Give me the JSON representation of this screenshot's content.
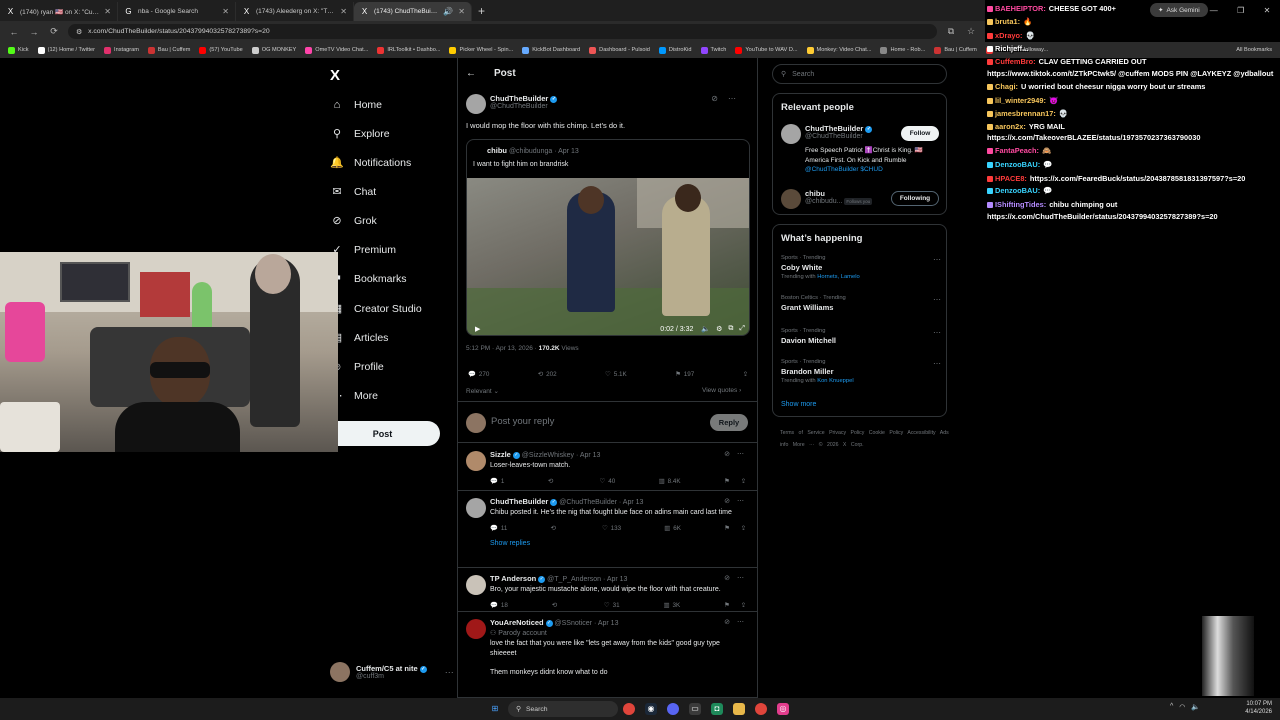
{
  "browser": {
    "tabs": [
      {
        "label": "(1740) ryan 🇺🇸 on X: \"Cuffem ...",
        "fav": "X",
        "active": false
      },
      {
        "label": "nba - Google Search",
        "fav": "G",
        "active": false
      },
      {
        "label": "(1743) Aleederg on X: \"This is th...",
        "fav": "X",
        "active": false
      },
      {
        "label": "(1743) ChudTheBuilder on",
        "fav": "X",
        "active": true
      }
    ],
    "new_tab": "+",
    "url": "x.com/ChudTheBuilder/status/2043799403257827389?s=20",
    "ask_gemini": "Ask Gemini",
    "all_bookmarks": "All Bookmarks",
    "bookmarks": [
      "Kick",
      "(12) Home / Twitter",
      "Instagram",
      "Bau | Cuffem",
      "(57) YouTube",
      "OG MONKEY",
      "OmeTV Video Chat...",
      "IRLToolkit • Dashbo...",
      "Picker Wheel - Spin...",
      "KickBot Dashboard",
      "Dashboard - Pulsoid",
      "DistroKid",
      "Twitch",
      "YouTube to WAV D...",
      "Monkey: Video Chat...",
      "Home - Rob...",
      "Bau | Cuffem",
      "UFC 326: Holloway..."
    ]
  },
  "nav": {
    "logo": "X",
    "items": [
      {
        "label": "Home",
        "icon": "⌂",
        "name": "home"
      },
      {
        "label": "Explore",
        "icon": "⚲",
        "name": "explore"
      },
      {
        "label": "Notifications",
        "icon": "🔔",
        "name": "notifications",
        "badge": "20"
      },
      {
        "label": "Chat",
        "icon": "✉",
        "name": "chat",
        "badge": "20+"
      },
      {
        "label": "Grok",
        "icon": "⊘",
        "name": "grok"
      },
      {
        "label": "Premium",
        "icon": "✓",
        "name": "premium"
      },
      {
        "label": "Bookmarks",
        "icon": "⚑",
        "name": "bookmarks"
      },
      {
        "label": "Creator Studio",
        "icon": "▦",
        "name": "creator-studio"
      },
      {
        "label": "Articles",
        "icon": "▤",
        "name": "articles"
      },
      {
        "label": "Profile",
        "icon": "☺",
        "name": "profile"
      },
      {
        "label": "More",
        "icon": "⋯",
        "name": "more"
      }
    ],
    "post_button": "Post",
    "account": {
      "name": "Cuffem/C5 at nite",
      "handle": "@cuff3m"
    }
  },
  "post": {
    "header": "Post",
    "author": {
      "name": "ChudTheBuilder",
      "handle": "@ChudTheBuilder"
    },
    "text": "I would mop the floor with this chimp. Let’s do it.",
    "quote": {
      "name": "chibu",
      "handle": "@chibudunga",
      "date": "· Apr 13",
      "text": "I want to fight him on brandrisk",
      "video_time": "0:02 / 3:32"
    },
    "timestamp": "5:12 PM · Apr 13, 2026 ·",
    "views_count": "170.2K",
    "views_label": "Views",
    "stats": {
      "replies": "270",
      "reposts": "202",
      "likes": "5.1K",
      "bookmarks": "197"
    },
    "relevant": "Relevant",
    "view_quotes": "View quotes",
    "reply_placeholder": "Post your reply",
    "reply_button": "Reply"
  },
  "replies": [
    {
      "name": "Sizzle",
      "handle": "@SizzleWhiskey",
      "date": "· Apr 13",
      "text": "Loser-leaves-town match.",
      "stats": {
        "replies": "1",
        "reposts": "",
        "likes": "40",
        "views": "8.4K"
      }
    },
    {
      "name": "ChudTheBuilder",
      "handle": "@ChudTheBuilder",
      "date": "· Apr 13",
      "text": "Chibu posted it. He’s the nig that fought blue face on adins main card last time",
      "stats": {
        "replies": "11",
        "reposts": "",
        "likes": "133",
        "views": "6K"
      },
      "show_replies": "Show replies"
    },
    {
      "name": "TP Anderson",
      "handle": "@T_P_Anderson",
      "date": "· Apr 13",
      "text": "Bro, your majestic mustache alone, would wipe the floor with that creature.",
      "stats": {
        "replies": "18",
        "reposts": "",
        "likes": "31",
        "views": "3K"
      }
    },
    {
      "name": "YouAreNoticed",
      "handle": "@SSnoticer",
      "date": "· Apr 13",
      "tag": "Parody account",
      "text": "love the fact that you were like \"lets get away from the kids\" good guy type shieeeet",
      "text2": "Them monkeys didnt know what to do"
    }
  ],
  "sidebar": {
    "search_placeholder": "Search",
    "relevant_people_title": "Relevant people",
    "people": [
      {
        "name": "ChudTheBuilder",
        "handle": "@ChudTheBuilder",
        "bio": "Free Speech Patriot ✝️Christ is King. 🇺🇸America First. On Kick and Rumble",
        "bio_links": "@ChudTheBuilder $CHUD",
        "button": "Follow"
      },
      {
        "name": "chibu",
        "handle": "@chibudu...",
        "follows_you": "Follows you",
        "button": "Following"
      }
    ],
    "happening_title": "What’s happening",
    "trends": [
      {
        "meta": "Sports · Trending",
        "title": "Coby White",
        "with_label": "Trending with",
        "with": "Hornets, Lamelo"
      },
      {
        "meta": "Boston Celtics · Trending",
        "title": "Grant Williams"
      },
      {
        "meta": "Sports · Trending",
        "title": "Davion Mitchell"
      },
      {
        "meta": "Sports · Trending",
        "title": "Brandon Miller",
        "with_label": "Trending with",
        "with": "Kon Knueppel"
      }
    ],
    "show_more": "Show more",
    "footer": "Terms of Service   Privacy Policy   Cookie Policy   Accessibility   Ads info   More ···   © 2026 X Corp."
  },
  "chat": [
    {
      "user": "BAEHEIPTOR:",
      "msg": "CHEESE GOT 400+",
      "color": "#ff4aa0"
    },
    {
      "user": "bruta1:",
      "msg": "🔥",
      "color": "#f7c65c"
    },
    {
      "user": "xDrayo:",
      "msg": "💀",
      "color": "#ff3b3b"
    },
    {
      "user": "Richjeff...",
      "msg": "",
      "color": "#ffffff"
    },
    {
      "user": "CuffemBro:",
      "msg": "CLAV GETTING CARRIED OUT",
      "color": "#ff3b3b"
    },
    {
      "user": "",
      "msg": "https://www.tiktok.com/t/ZTkPCtwk5/ @cuffem MODS PIN @LAYKEYZ @ydballout",
      "color": "#ffffff"
    },
    {
      "user": "Chagi:",
      "msg": "U worried bout cheesur nigga worry bout ur streams",
      "color": "#f7c65c"
    },
    {
      "user": "lil_winter2949:",
      "msg": "😈",
      "color": "#f7c65c"
    },
    {
      "user": "jamesbrennan17:",
      "msg": "💀",
      "color": "#f7c65c"
    },
    {
      "user": "aaron2x:",
      "msg": "YRG MAIL",
      "color": "#f7c65c"
    },
    {
      "user": "",
      "msg": "https://x.com/TakeoverBLAZEE/status/1973570237363790030",
      "color": "#ffffff"
    },
    {
      "user": "FantaPeach:",
      "msg": "🙈",
      "color": "#ff4aa0"
    },
    {
      "user": "DenzooBAU:",
      "msg": "💬",
      "color": "#39d4ff"
    },
    {
      "user": "HPACE8:",
      "msg": "https://x.com/FearedBuck/status/2043878581831397597?s=20",
      "color": "#ff3b3b"
    },
    {
      "user": "DenzooBAU:",
      "msg": "💬",
      "color": "#39d4ff"
    },
    {
      "user": "IShiftingTides:",
      "msg": "chibu chimping out",
      "color": "#b48bff"
    },
    {
      "user": "",
      "msg": "https://x.com/ChudTheBuilder/status/2043799403257827389?s=20",
      "color": "#ffffff"
    }
  ],
  "taskbar": {
    "search_placeholder": "Search",
    "time": "10:07 PM",
    "date": "4/14/2026"
  }
}
